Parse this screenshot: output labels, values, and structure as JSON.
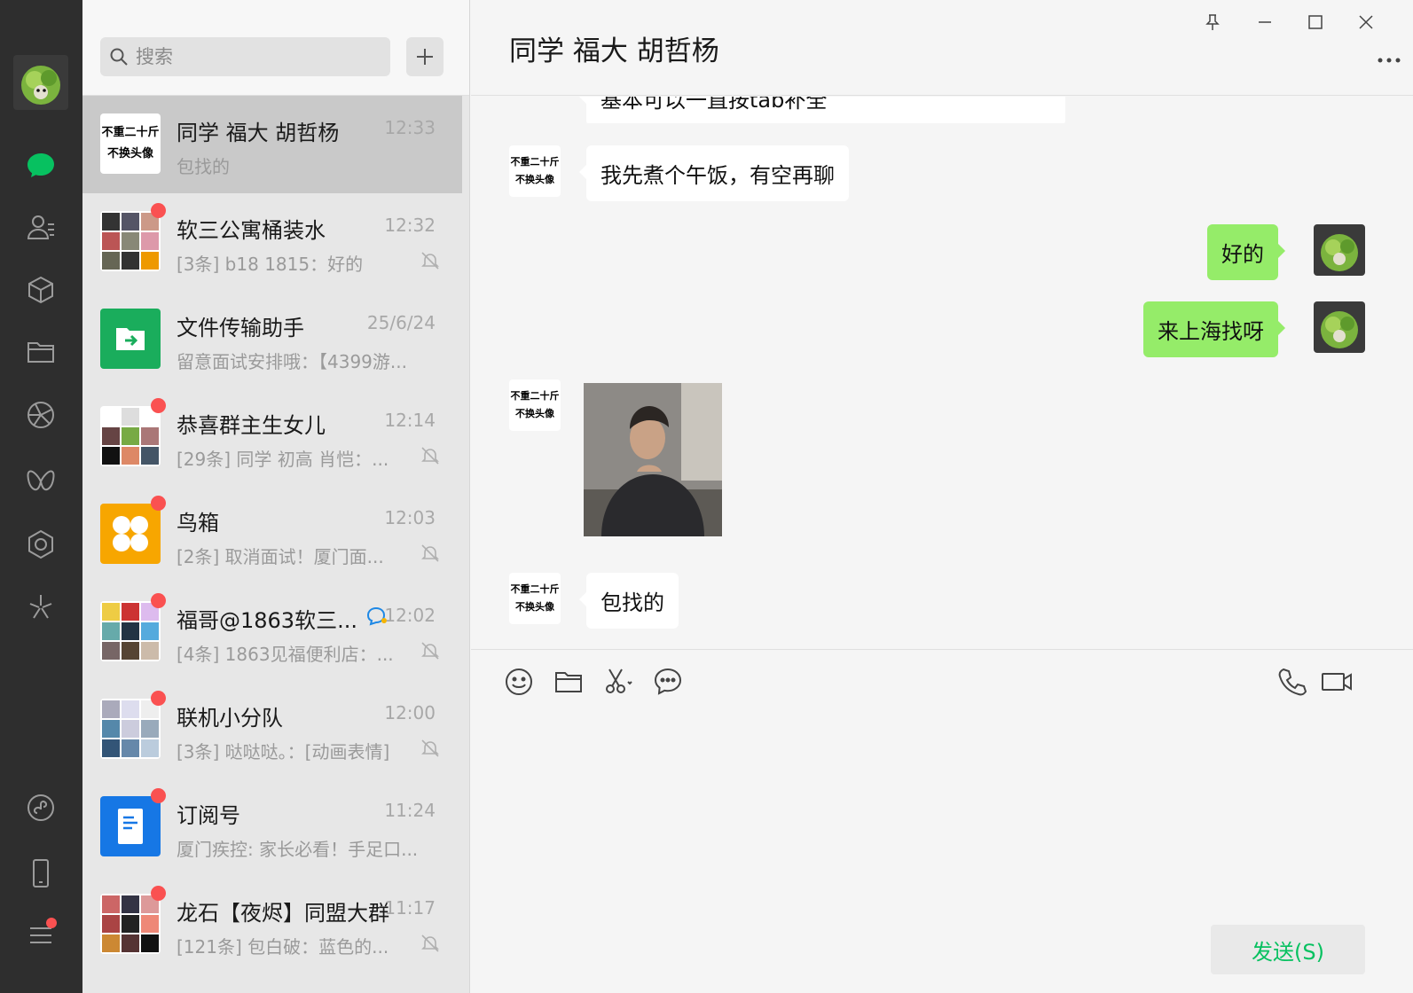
{
  "search": {
    "placeholder": "搜索"
  },
  "conversations": [
    {
      "name": "同学 福大 胡哲杨",
      "time": "12:33",
      "preview": "包找的",
      "avatar_text_1": "不重二十斤",
      "avatar_text_2": "不换头像",
      "unread": false,
      "muted": false
    },
    {
      "name": "软三公寓桶装水",
      "time": "12:32",
      "preview": "[3条] b18 1815：好的",
      "unread": true,
      "muted": true
    },
    {
      "name": "文件传输助手",
      "time": "25/6/24",
      "preview": "留意面试安排哦：【4399游...",
      "unread": false,
      "muted": false
    },
    {
      "name": "恭喜群主生女儿",
      "time": "12:14",
      "preview": "[29条] 同学 初高 肖恺：...",
      "unread": true,
      "muted": true
    },
    {
      "name": "鸟箱",
      "time": "12:03",
      "preview": "[2条] 取消面试！厦门面...",
      "unread": true,
      "muted": true
    },
    {
      "name": "福哥@1863软三...",
      "time": "12:02",
      "preview": "[4条] 1863见福便利店：...",
      "unread": true,
      "muted": true,
      "mention": true
    },
    {
      "name": "联机小分队",
      "time": "12:00",
      "preview": "[3条] 哒哒哒。：[动画表情]",
      "unread": true,
      "muted": true
    },
    {
      "name": "订阅号",
      "time": "11:24",
      "preview": "厦门疾控: 家长必看！手足口...",
      "unread": true,
      "muted": false
    },
    {
      "name": "龙石【夜烬】同盟大群",
      "time": "11:17",
      "preview": "[121条] 包白破：蓝色的...",
      "unread": true,
      "muted": true
    }
  ],
  "chat": {
    "title": "同学 福大 胡哲杨",
    "messages": [
      {
        "from": "them",
        "type": "text",
        "text": "基本可以一直按tab补全"
      },
      {
        "from": "them",
        "type": "text",
        "text": "我先煮个午饭，有空再聊"
      },
      {
        "from": "me",
        "type": "text",
        "text": "好的"
      },
      {
        "from": "me",
        "type": "text",
        "text": "来上海找呀"
      },
      {
        "from": "them",
        "type": "image"
      },
      {
        "from": "them",
        "type": "text",
        "text": "包找的"
      }
    ],
    "send_label": "发送(S)"
  },
  "colors": {
    "rail": "#2e2e2e",
    "accent_green": "#07c160",
    "bubble_out": "#95ec69",
    "unread_badge": "#fa5151"
  },
  "icons": {
    "rail": [
      "chat-icon",
      "contacts-icon",
      "favorites-icon",
      "files-icon",
      "moments-icon",
      "channels-icon",
      "search-icon",
      "mini-programs-icon",
      "phone-icon",
      "menu-icon"
    ],
    "composer": [
      "emoji-icon",
      "folder-icon",
      "scissors-icon",
      "chat-history-icon",
      "voice-call-icon",
      "video-call-icon"
    ],
    "window": [
      "pin-icon",
      "minimize-icon",
      "maximize-icon",
      "close-icon",
      "more-icon"
    ]
  }
}
